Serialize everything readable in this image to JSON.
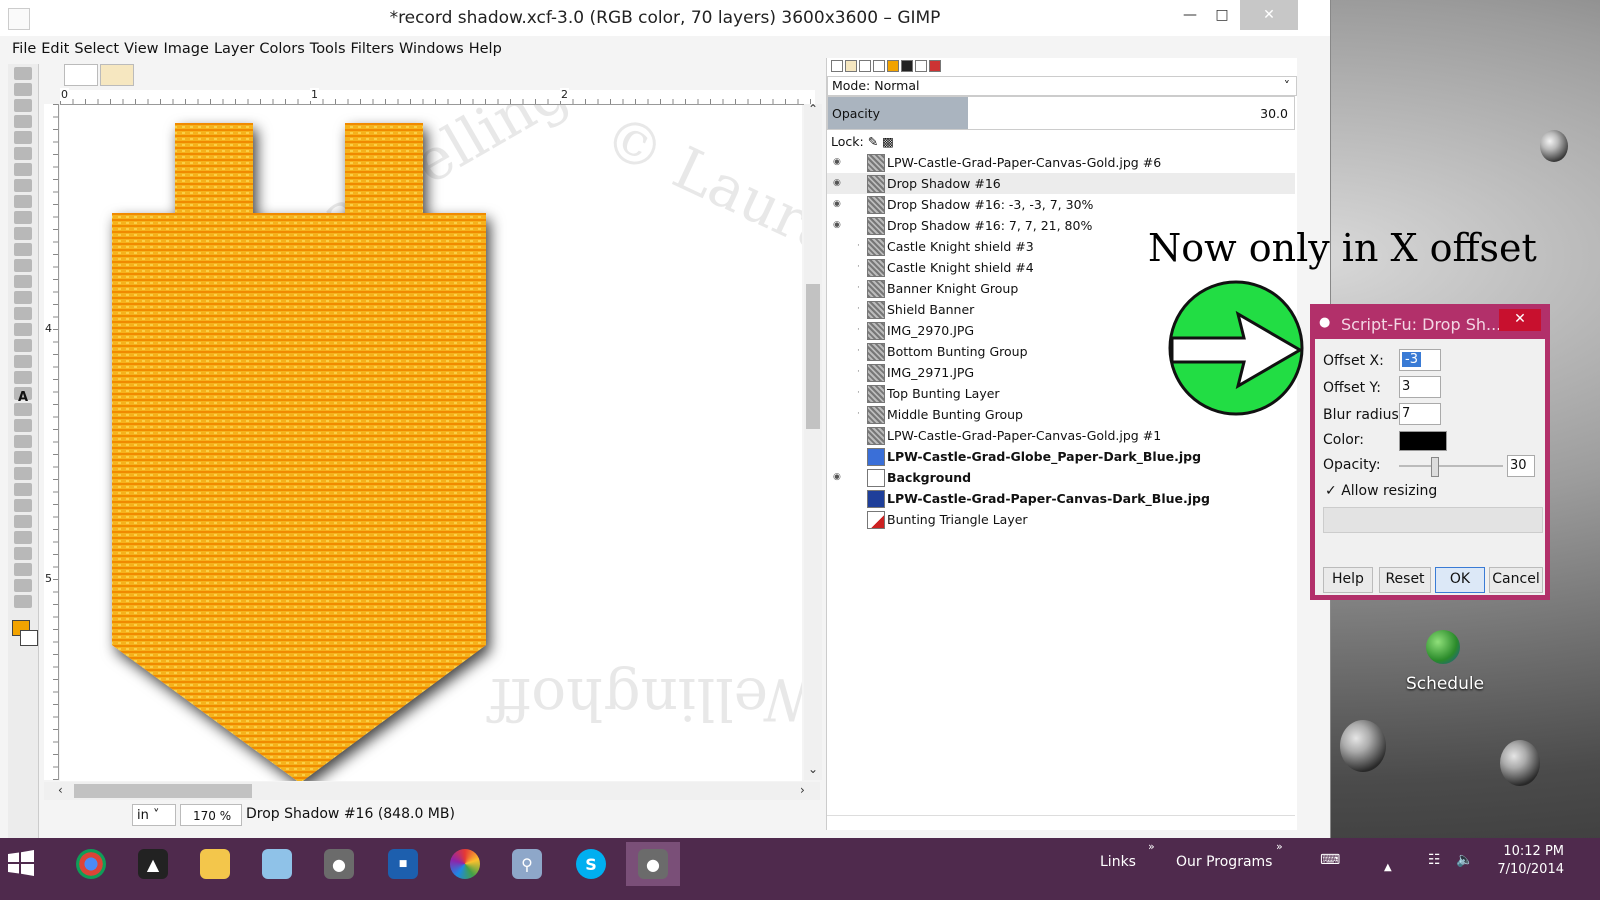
{
  "window": {
    "title": "*record shadow.xcf-3.0 (RGB color, 70 layers) 3600x3600 – GIMP",
    "minimize_icon": "minimize-icon",
    "maximize_icon": "maximize-icon",
    "close_icon": "close-icon"
  },
  "menu": [
    {
      "label": "File"
    },
    {
      "label": "Edit"
    },
    {
      "label": "Select"
    },
    {
      "label": "View"
    },
    {
      "label": "Image"
    },
    {
      "label": "Layer"
    },
    {
      "label": "Colors"
    },
    {
      "label": "Tools"
    },
    {
      "label": "Filters"
    },
    {
      "label": "Windows"
    },
    {
      "label": "Help"
    }
  ],
  "ruler": {
    "top": [
      "0",
      "1",
      "2"
    ],
    "left": [
      "4",
      "5"
    ]
  },
  "canvas": {
    "watermark": "© Laura Wellinghoff",
    "shape_color": "#f2a300"
  },
  "statusbar": {
    "unit": "in",
    "zoom": "170 %",
    "message": "Drop Shadow #16 (848.0 MB)"
  },
  "layers_panel": {
    "mode": "Mode: Normal",
    "opacity_label": "Opacity",
    "opacity_value": "30.0",
    "opacity_fraction": 0.3,
    "lock_label": "Lock:",
    "layers": [
      {
        "name": "LPW-Castle-Grad-Paper-Canvas-Gold.jpg #6",
        "visible": true,
        "selected": false,
        "bold": false,
        "thumb": "pattern"
      },
      {
        "name": "Drop Shadow #16",
        "visible": true,
        "selected": true,
        "bold": false,
        "thumb": "pattern"
      },
      {
        "name": "Drop Shadow #16: -3, -3, 7, 30%",
        "visible": true,
        "selected": false,
        "bold": false,
        "thumb": "pattern"
      },
      {
        "name": "Drop Shadow #16: 7, 7, 21, 80%",
        "visible": true,
        "selected": false,
        "bold": false,
        "thumb": "pattern"
      },
      {
        "name": "Castle Knight shield #3",
        "visible": false,
        "selected": false,
        "bold": false,
        "thumb": "pattern"
      },
      {
        "name": "Castle Knight shield #4",
        "visible": false,
        "selected": false,
        "bold": false,
        "thumb": "pattern"
      },
      {
        "name": "Banner Knight Group",
        "visible": false,
        "selected": false,
        "bold": false,
        "thumb": "pattern"
      },
      {
        "name": "Shield Banner",
        "visible": false,
        "selected": false,
        "bold": false,
        "thumb": "pattern"
      },
      {
        "name": "IMG_2970.JPG",
        "visible": false,
        "selected": false,
        "bold": false,
        "thumb": "pattern"
      },
      {
        "name": "Bottom Bunting Group",
        "visible": false,
        "selected": false,
        "bold": false,
        "thumb": "pattern"
      },
      {
        "name": "IMG_2971.JPG",
        "visible": false,
        "selected": false,
        "bold": false,
        "thumb": "pattern"
      },
      {
        "name": "Top Bunting Layer",
        "visible": false,
        "selected": false,
        "bold": false,
        "thumb": "pattern"
      },
      {
        "name": "Middle Bunting Group",
        "visible": false,
        "selected": false,
        "bold": false,
        "thumb": "pattern"
      },
      {
        "name": "LPW-Castle-Grad-Paper-Canvas-Gold.jpg #1",
        "visible": false,
        "selected": false,
        "bold": false,
        "thumb": "pattern"
      },
      {
        "name": "LPW-Castle-Grad-Globe_Paper-Dark_Blue.jpg",
        "visible": false,
        "selected": false,
        "bold": true,
        "thumb": "blue"
      },
      {
        "name": "Background",
        "visible": true,
        "selected": false,
        "bold": true,
        "thumb": "white"
      },
      {
        "name": "LPW-Castle-Grad-Paper-Canvas-Dark_Blue.jpg",
        "visible": false,
        "selected": false,
        "bold": true,
        "thumb": "darkblue"
      },
      {
        "name": "Bunting Triangle Layer",
        "visible": false,
        "selected": false,
        "bold": false,
        "thumb": "red"
      }
    ]
  },
  "annotation": {
    "text": "Now only in X offset",
    "arrow_color": "#22dd44"
  },
  "dialog": {
    "title": "Script-Fu: Drop Sh...",
    "offset_x_label": "Offset X:",
    "offset_x_value": "-3",
    "offset_y_label": "Offset Y:",
    "offset_y_value": "3",
    "blur_label": "Blur radius:",
    "blur_value": "7",
    "color_label": "Color:",
    "color_value": "#000000",
    "opacity_label": "Opacity:",
    "opacity_value": "30",
    "allow_resizing_label": "Allow resizing",
    "allow_resizing_checked": true,
    "buttons": {
      "help": "Help",
      "reset": "Reset",
      "ok": "OK",
      "cancel": "Cancel"
    },
    "border_color": "#b2306a"
  },
  "desktop": {
    "schedule_label": "Schedule"
  },
  "taskbar": {
    "links_label": "Links",
    "programs_label": "Our Programs",
    "time": "10:12 PM",
    "date": "7/10/2014",
    "color": "#4f2a4d",
    "apps": [
      "chrome",
      "inkscape",
      "file-explorer",
      "notepad",
      "gimp",
      "lenovo",
      "picasa",
      "search",
      "skype",
      "gimp-active"
    ]
  }
}
